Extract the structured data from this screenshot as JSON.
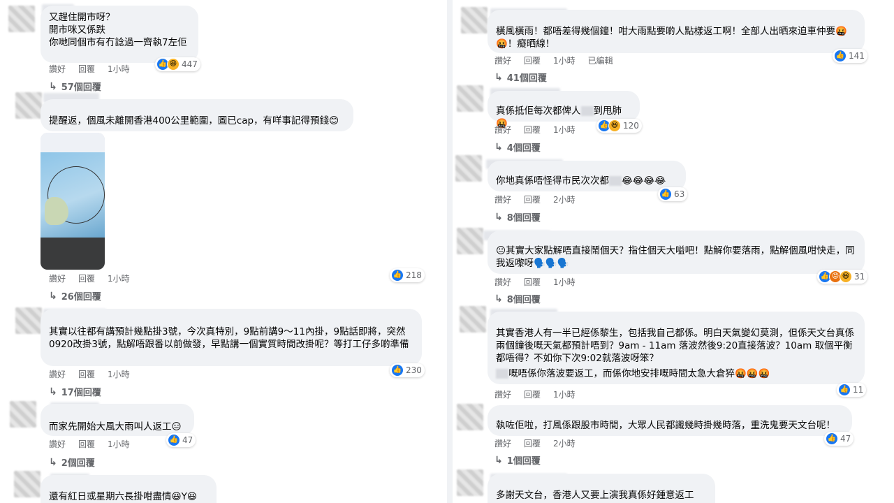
{
  "action_labels": {
    "like": "讚好",
    "reply": "回覆",
    "edited": "已編輯"
  },
  "left_comments": [
    {
      "text": "又趕住開市呀？\n開市咪又係跌\n你哋同個市有冇諗過一齊執7左佢",
      "time": "1小時",
      "reaction_count": "447",
      "replies": "57個回覆"
    },
    {
      "text": "提醒返，個風未離開香港400公里範圍，圖已cap，有咩事記得預錢😊",
      "time": "1小時",
      "reaction_count": "218",
      "replies": "26個回覆"
    },
    {
      "text": "其實以往都有講預計幾點掛3號，今次真特別，9點前講9～11內掛，9點話即將，突然0920改掛3號，點解唔跟番以前做發，早點講一個實質時間改掛呢？等打工仔多啲準備",
      "time": "1小時",
      "reaction_count": "230",
      "replies": "17個回覆"
    },
    {
      "text": "而家先開始大風大雨叫人返工😑",
      "time": "1小時",
      "reaction_count": "47",
      "replies": "2個回覆"
    },
    {
      "text": "還有紅日或星期六長掛咁盡情😆Y😆"
    }
  ],
  "right_comments": [
    {
      "text": "橫風橫雨！都唔差得幾個鐘！咁大雨點要啲人點樣返工啊！全部人出晒來迫車仲要🤬🤬！癡晒線！",
      "time": "1小時",
      "reaction_count": "141",
      "replies": "41個回覆"
    },
    {
      "text": "真係抵佢每次都俾人",
      "text_after": "到甩肺🤬",
      "time": "1小時",
      "reaction_count": "120",
      "replies": "4個回覆"
    },
    {
      "text": "你地真係唔怪得市民次次都",
      "text_after": "😂😂😂😂",
      "time": "2小時",
      "reaction_count": "63",
      "replies": "8個回覆"
    },
    {
      "text": "😐其實大家點解唔直接鬧個天？指住個天大嗌吧！點解你要落雨，點解個風咁快走，同我返嚟呀🗣️🗣️🗣️",
      "time": "1小時",
      "reaction_count": "31",
      "replies": "8個回覆"
    },
    {
      "text": "其實香港人有一半已經係黎生，包括我自己都係。明白天氣變幻莫測，但係天文台真係兩個鐘後嘅天氣都預計唔到？9am - 11am 落波然後9:20直接落波？10am 取個平衡都唔得？不如你下次9:02就落波呀笨？",
      "text2": "嘅唔係你落波要返工，而係你地安排嘅時間太急大倉猝🤬🤬🤬",
      "time": "1小時",
      "reaction_count": "11"
    },
    {
      "text": "執咗佢啦，打風係跟股市時間，大眾人民都識幾時掛幾時落，重洗鬼要天文台呢！",
      "time": "2小時",
      "reaction_count": "47",
      "replies": "1個回覆"
    },
    {
      "text": "多謝天文台，香港人又要上演我真係好鍾意返工"
    }
  ]
}
